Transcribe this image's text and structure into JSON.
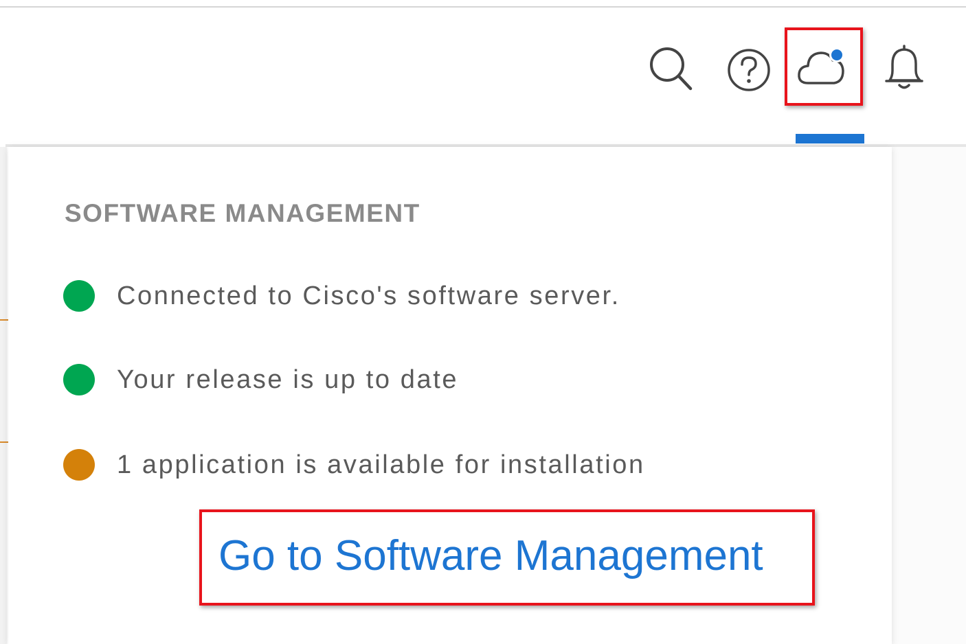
{
  "header": {
    "icons": [
      {
        "name": "search-icon"
      },
      {
        "name": "help-icon"
      },
      {
        "name": "cloud-icon",
        "badge_color": "#1d75d2",
        "active": true
      },
      {
        "name": "bell-icon"
      }
    ],
    "active_indicator_color": "#1d75d2"
  },
  "dropdown": {
    "title": "SOFTWARE MANAGEMENT",
    "status_items": [
      {
        "text": "Connected to Cisco's software server.",
        "color": "#00a651"
      },
      {
        "text": "Your release is up to date",
        "color": "#00a651"
      },
      {
        "text": "1 application is available for installation",
        "color": "#d4810a"
      }
    ],
    "link_label": "Go to Software Management",
    "link_color": "#1d75d2"
  },
  "annotations": {
    "highlight_color": "#e8141c"
  }
}
